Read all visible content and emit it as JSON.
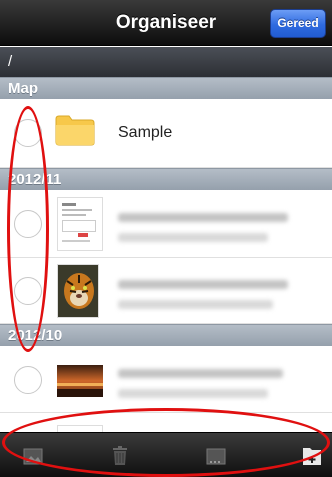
{
  "navbar": {
    "title": "Organiseer",
    "done_label": "Gereed"
  },
  "path": "/",
  "sections": [
    {
      "label": "Map"
    },
    {
      "label": "2012/11"
    },
    {
      "label": "2012/10"
    }
  ],
  "folder_row": {
    "label": "Sample"
  },
  "toolbar": {
    "icons": [
      "photo-icon",
      "trash-icon",
      "rename-icon",
      "new-folder-icon"
    ]
  },
  "colors": {
    "annotation": "#e01010",
    "done_button": "#2f6be0"
  }
}
